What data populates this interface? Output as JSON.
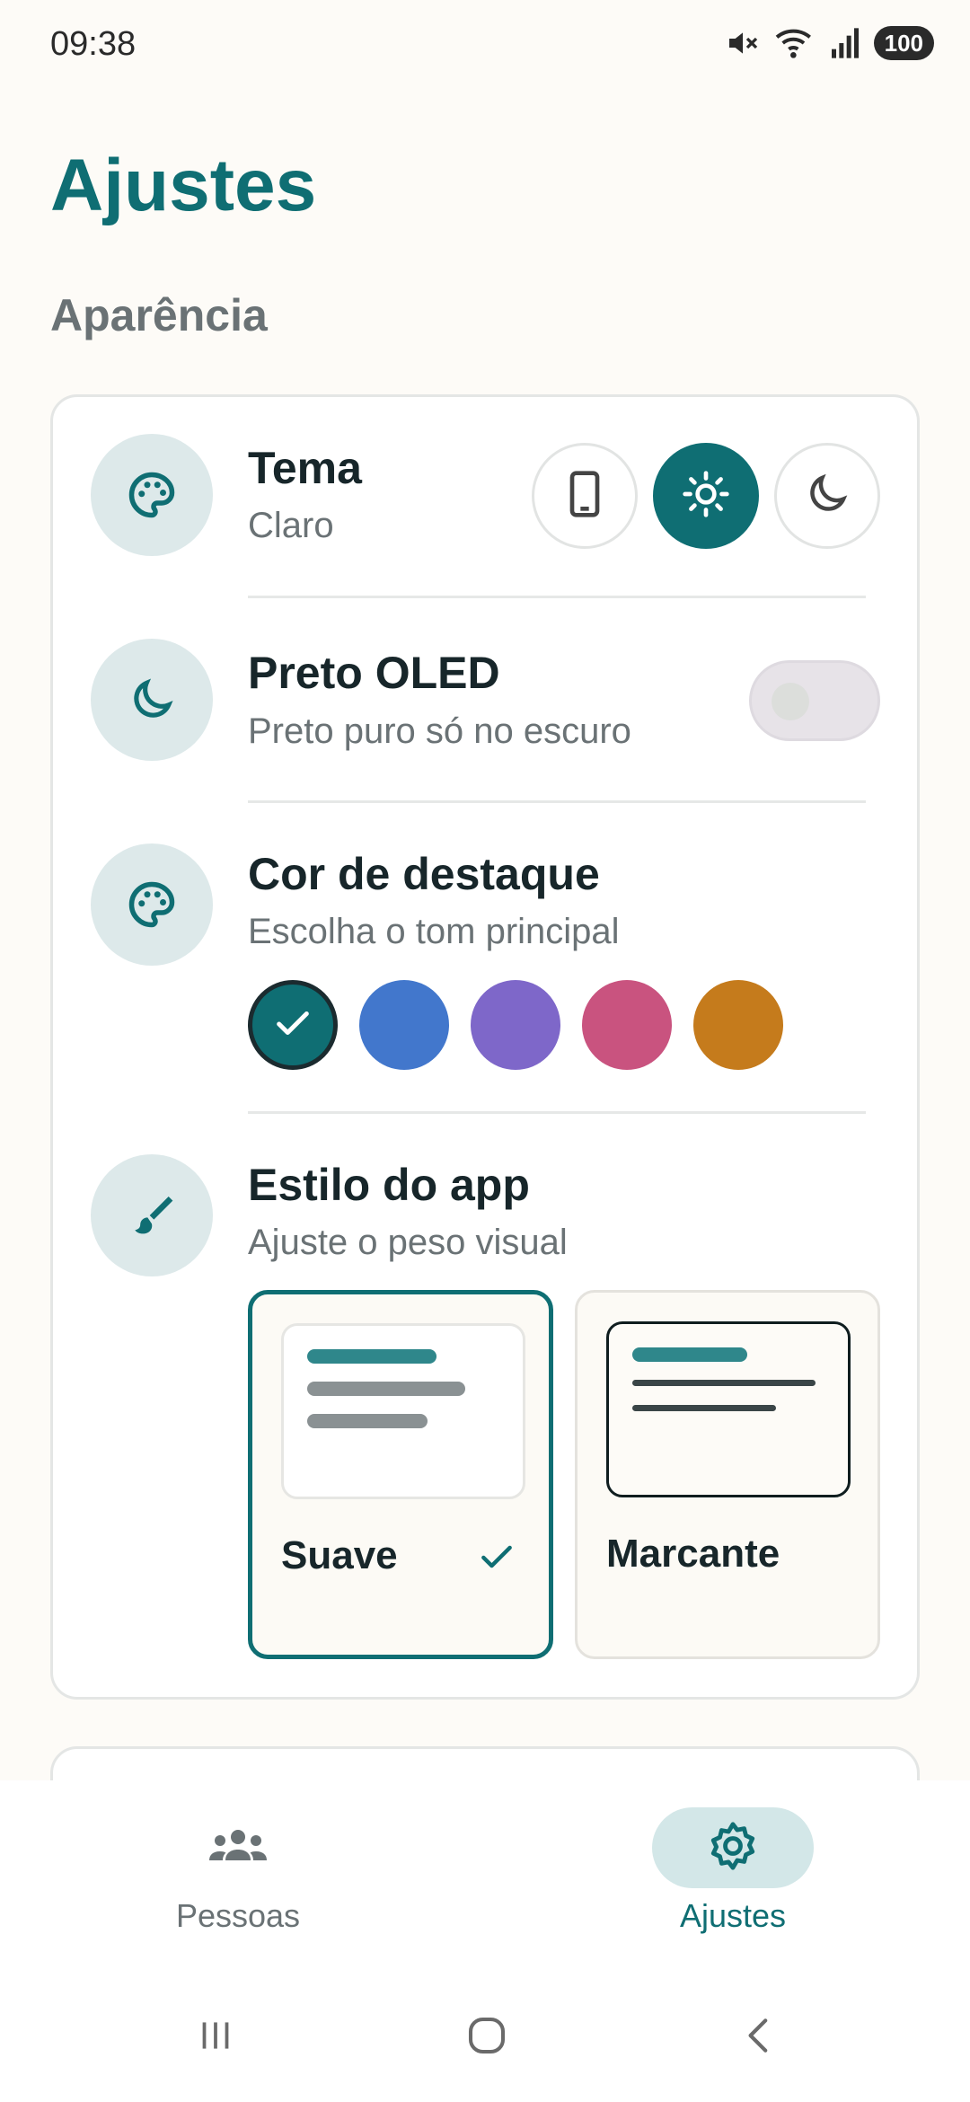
{
  "status_bar": {
    "time": "09:38",
    "battery": "100",
    "icons": [
      "mute-icon",
      "wifi-icon",
      "signal-icon",
      "battery-icon"
    ]
  },
  "page": {
    "title": "Ajustes",
    "section": "Aparência"
  },
  "theme": {
    "title": "Tema",
    "value": "Claro",
    "options": [
      "phone-icon",
      "sun-icon",
      "moon-icon"
    ],
    "selected": "sun-icon"
  },
  "oled": {
    "title": "Preto OLED",
    "subtitle": "Preto puro só no escuro",
    "enabled": false
  },
  "accent": {
    "title": "Cor de destaque",
    "subtitle": "Escolha o tom principal",
    "colors": [
      "#0F6E73",
      "#4277CC",
      "#7E67C9",
      "#C9537F",
      "#C57B1C"
    ],
    "selected_index": 0
  },
  "app_style": {
    "title": "Estilo do app",
    "subtitle": "Ajuste o peso visual",
    "options": [
      {
        "label": "Suave",
        "selected": true
      },
      {
        "label": "Marcante",
        "selected": false
      }
    ]
  },
  "bottom_nav": {
    "items": [
      {
        "label": "Pessoas",
        "icon": "people-icon",
        "active": false
      },
      {
        "label": "Ajustes",
        "icon": "gear-icon",
        "active": true
      }
    ]
  },
  "colors": {
    "accent": "#0F6E73",
    "background": "#FDFBF7",
    "icon_bg": "#DDE9EA"
  }
}
